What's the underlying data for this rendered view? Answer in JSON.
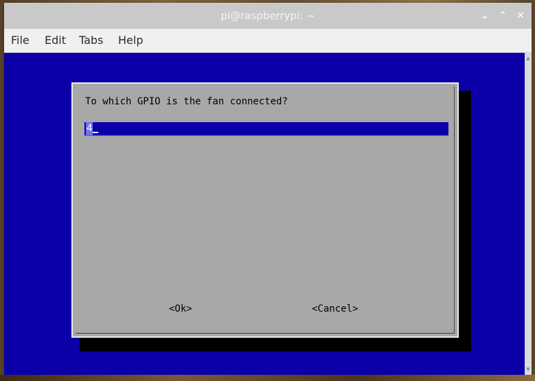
{
  "window": {
    "title": "pi@raspberrypi: ~",
    "controls": {
      "minimize": "⌄",
      "maximize": "⌃",
      "close": "✕"
    }
  },
  "menubar": {
    "items": [
      "File",
      "Edit",
      "Tabs",
      "Help"
    ]
  },
  "dialog": {
    "prompt": "To which GPIO is the fan connected?",
    "input_value": "4",
    "ok_label": "<Ok>",
    "cancel_label": "<Cancel>"
  },
  "colors": {
    "terminal_bg": "#0b00a8",
    "dialog_bg": "#a8a8a8",
    "titlebar_bg": "#c9c9c9"
  }
}
